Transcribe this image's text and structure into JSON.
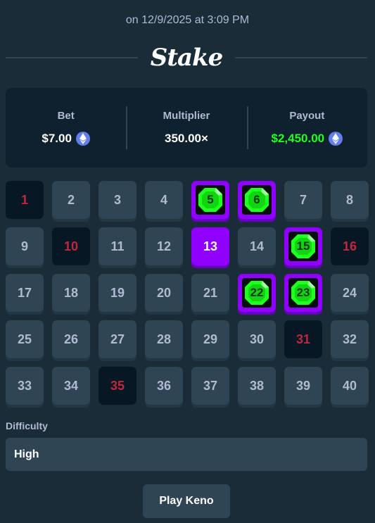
{
  "header": {
    "timestamp": "on 12/9/2025 at 3:09 PM",
    "brand": "Stake"
  },
  "stats": {
    "bet_label": "Bet",
    "bet_value": "$7.00",
    "bet_currency_icon": "ethereum-icon",
    "multiplier_label": "Multiplier",
    "multiplier_value": "350.00×",
    "payout_label": "Payout",
    "payout_value": "$2,450.00",
    "payout_currency_icon": "ethereum-icon"
  },
  "colors": {
    "background": "#1a2c38",
    "panel": "#0f212e",
    "tile": "#2f4553",
    "selected": "#9000ff",
    "miss_text": "#c0273f",
    "gem": "#1fff20",
    "payout": "#1fff20",
    "ethereum": "#627eea"
  },
  "board": {
    "tiles": [
      {
        "n": "1",
        "state": "miss"
      },
      {
        "n": "2",
        "state": "default"
      },
      {
        "n": "3",
        "state": "default"
      },
      {
        "n": "4",
        "state": "default"
      },
      {
        "n": "5",
        "state": "hit"
      },
      {
        "n": "6",
        "state": "hit"
      },
      {
        "n": "7",
        "state": "default"
      },
      {
        "n": "8",
        "state": "default"
      },
      {
        "n": "9",
        "state": "default"
      },
      {
        "n": "10",
        "state": "miss"
      },
      {
        "n": "11",
        "state": "default"
      },
      {
        "n": "12",
        "state": "default"
      },
      {
        "n": "13",
        "state": "selected"
      },
      {
        "n": "14",
        "state": "default"
      },
      {
        "n": "15",
        "state": "hit"
      },
      {
        "n": "16",
        "state": "miss"
      },
      {
        "n": "17",
        "state": "default"
      },
      {
        "n": "18",
        "state": "default"
      },
      {
        "n": "19",
        "state": "default"
      },
      {
        "n": "20",
        "state": "default"
      },
      {
        "n": "21",
        "state": "default"
      },
      {
        "n": "22",
        "state": "hit"
      },
      {
        "n": "23",
        "state": "hit"
      },
      {
        "n": "24",
        "state": "default"
      },
      {
        "n": "25",
        "state": "default"
      },
      {
        "n": "26",
        "state": "default"
      },
      {
        "n": "27",
        "state": "default"
      },
      {
        "n": "28",
        "state": "default"
      },
      {
        "n": "29",
        "state": "default"
      },
      {
        "n": "30",
        "state": "default"
      },
      {
        "n": "31",
        "state": "miss"
      },
      {
        "n": "32",
        "state": "default"
      },
      {
        "n": "33",
        "state": "default"
      },
      {
        "n": "34",
        "state": "default"
      },
      {
        "n": "35",
        "state": "miss"
      },
      {
        "n": "36",
        "state": "default"
      },
      {
        "n": "37",
        "state": "default"
      },
      {
        "n": "38",
        "state": "default"
      },
      {
        "n": "39",
        "state": "default"
      },
      {
        "n": "40",
        "state": "default"
      }
    ]
  },
  "difficulty": {
    "label": "Difficulty",
    "value": "High"
  },
  "actions": {
    "play_label": "Play Keno"
  }
}
